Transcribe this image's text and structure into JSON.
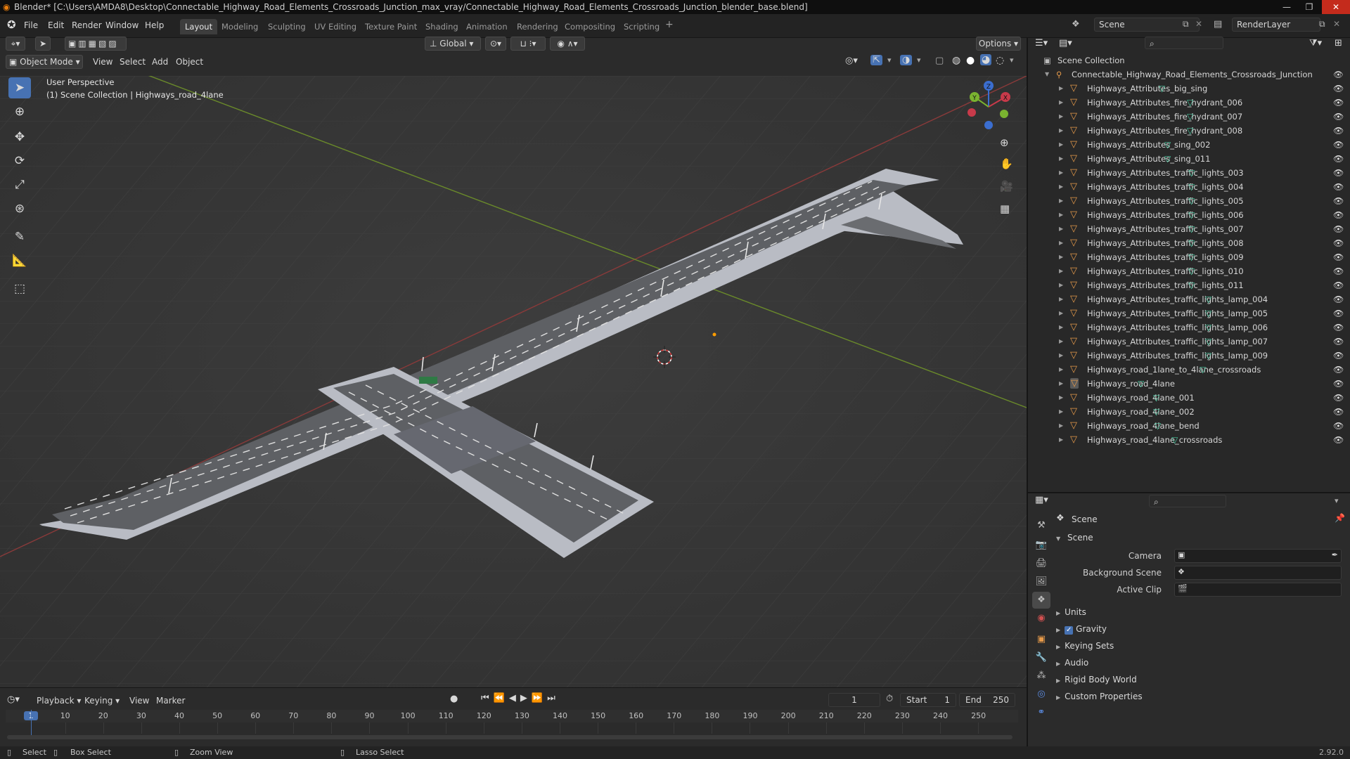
{
  "titlebar": {
    "title": "Blender* [C:\\Users\\AMDA8\\Desktop\\Connectable_Highway_Road_Elements_Crossroads_Junction_max_vray/Connectable_Highway_Road_Elements_Crossroads_Junction_blender_base.blend]"
  },
  "menu": {
    "file": "File",
    "edit": "Edit",
    "render": "Render",
    "window": "Window",
    "help": "Help"
  },
  "workspaces": [
    "Layout",
    "Modeling",
    "Sculpting",
    "UV Editing",
    "Texture Paint",
    "Shading",
    "Animation",
    "Rendering",
    "Compositing",
    "Scripting"
  ],
  "scene": {
    "name": "Scene",
    "renderlayer": "RenderLayer"
  },
  "viewport_header": {
    "transform_orientation": "Global",
    "options": "Options",
    "mode": "Object Mode",
    "view": "View",
    "select": "Select",
    "add": "Add",
    "object": "Object"
  },
  "viewport": {
    "perspective": "User Perspective",
    "collection_info": "(1) Scene Collection | Highways_road_4lane",
    "gizmo": {
      "x": "X",
      "y": "Y",
      "z": "Z"
    }
  },
  "outliner": {
    "root": "Scene Collection",
    "collection": "Connectable_Highway_Road_Elements_Crossroads_Junction",
    "items": [
      "Highways_Attributes_big_sing",
      "Highways_Attributes_fire_hydrant_006",
      "Highways_Attributes_fire_hydrant_007",
      "Highways_Attributes_fire_hydrant_008",
      "Highways_Attributes_sing_002",
      "Highways_Attributes_sing_011",
      "Highways_Attributes_traffic_lights_003",
      "Highways_Attributes_traffic_lights_004",
      "Highways_Attributes_traffic_lights_005",
      "Highways_Attributes_traffic_lights_006",
      "Highways_Attributes_traffic_lights_007",
      "Highways_Attributes_traffic_lights_008",
      "Highways_Attributes_traffic_lights_009",
      "Highways_Attributes_traffic_lights_010",
      "Highways_Attributes_traffic_lights_011",
      "Highways_Attributes_traffic_lights_lamp_004",
      "Highways_Attributes_traffic_lights_lamp_005",
      "Highways_Attributes_traffic_lights_lamp_006",
      "Highways_Attributes_traffic_lights_lamp_007",
      "Highways_Attributes_traffic_lights_lamp_009",
      "Highways_road_1lane_to_4lane_crossroads",
      "Highways_road_4lane",
      "Highways_road_4lane_001",
      "Highways_road_4lane_002",
      "Highways_road_4lane_bend",
      "Highways_road_4lane_crossroads"
    ],
    "selected_item": "Highways_road_4lane"
  },
  "properties": {
    "context": "Scene",
    "panel": "Scene",
    "camera_label": "Camera",
    "background_scene_label": "Background Scene",
    "active_clip_label": "Active Clip",
    "sections": [
      "Units",
      "Gravity",
      "Keying Sets",
      "Audio",
      "Rigid Body World",
      "Custom Properties"
    ],
    "gravity_enabled": true
  },
  "timeline": {
    "playback": "Playback",
    "keying": "Keying",
    "view": "View",
    "marker": "Marker",
    "current_frame": "1",
    "start_label": "Start",
    "start": "1",
    "end_label": "End",
    "end": "250",
    "ticks": [
      "1",
      "10",
      "20",
      "30",
      "40",
      "50",
      "60",
      "70",
      "80",
      "90",
      "100",
      "110",
      "120",
      "130",
      "140",
      "150",
      "160",
      "170",
      "180",
      "190",
      "200",
      "210",
      "220",
      "230",
      "240",
      "250"
    ]
  },
  "statusbar": {
    "select": "Select",
    "box_select": "Box Select",
    "zoom_view": "Zoom View",
    "lasso_select": "Lasso Select",
    "version": "2.92.0"
  }
}
